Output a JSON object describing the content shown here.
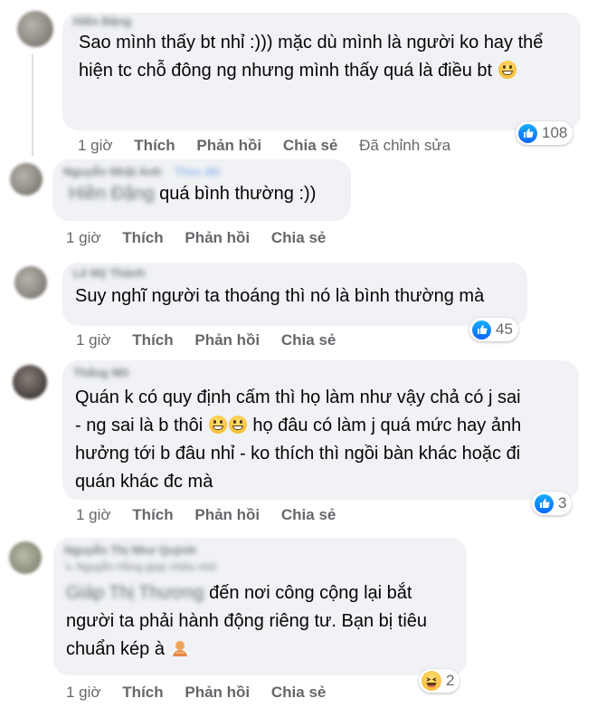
{
  "comments": [
    {
      "name": "Hiền Đặng",
      "text": "Sao mình thấy bt nhỉ :))) mặc dù mình là người ko hay thể hiện tc chỗ đông ng nhưng mình thấy quá là điều bt",
      "actions": {
        "time": "1 giờ",
        "like": "Thích",
        "reply": "Phản hồi",
        "share": "Chia sẻ",
        "edited": "Đã chỉnh sửa"
      },
      "reaction": {
        "icon": "like-icon",
        "count": "108"
      }
    },
    {
      "name": "Nguyễn Nhật Anh",
      "tag": "Theo dõi",
      "mention": "Hiền Đặng",
      "text": "quá bình thường :))",
      "actions": {
        "time": "1 giờ",
        "like": "Thích",
        "reply": "Phản hồi",
        "share": "Chia sẻ"
      }
    },
    {
      "name": "Lê Mỹ Thành",
      "text": "Suy nghĩ người ta thoáng thì nó là bình thường mà",
      "actions": {
        "time": "1 giờ",
        "like": "Thích",
        "reply": "Phản hồi",
        "share": "Chia sẻ"
      },
      "reaction": {
        "icon": "like-icon",
        "count": "45"
      }
    },
    {
      "name": "Thắng Mít",
      "text_line1": "Quán k có quy định cấm thì họ làm như vậy chả có j sai",
      "text_line2a": "- ng sai là b thôi",
      "text_line2b": "họ đâu có làm j quá mức hay ảnh",
      "text_line3": "hưởng tới b đâu nhỉ - ko thích thì ngồi bàn khác hoặc đi",
      "text_line4": "quán khác đc mà",
      "actions": {
        "time": "1 giờ",
        "like": "Thích",
        "reply": "Phản hồi",
        "share": "Chia sẻ"
      },
      "reaction": {
        "icon": "like-icon",
        "count": "3"
      }
    },
    {
      "name": "Nguyễn Thị Như Quỳnh",
      "reply_ref": "Nguyễn Hồng giúp chiều nhỏ",
      "mention": "Giáp Thị Thương",
      "text_line1": "đến nơi công cộng lại bắt",
      "text_line2": "người ta phải hành động riêng tư. Bạn bị tiêu",
      "text_line3": "chuẩn kép à",
      "actions": {
        "time": "1 giờ",
        "like": "Thích",
        "reply": "Phản hồi",
        "share": "Chia sẻ"
      },
      "reaction": {
        "icon": "haha-icon",
        "count": "2"
      }
    }
  ],
  "colors": {
    "bubble": "#f0f2f5",
    "like_blue": "#0866ff",
    "meta_gray": "#65676b"
  }
}
